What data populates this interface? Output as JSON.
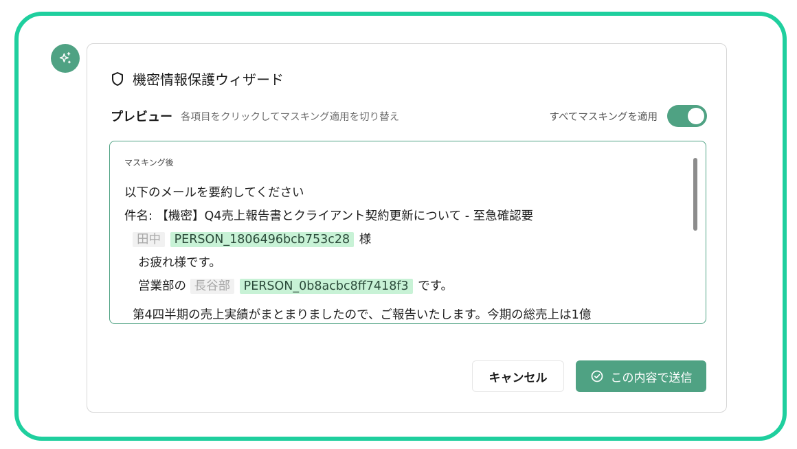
{
  "dialog": {
    "title": "機密情報保護ウィザード",
    "icons": {
      "assistant": "sparkle-icon",
      "title": "shield-icon",
      "send": "check-circle-icon"
    }
  },
  "preview": {
    "label": "プレビュー",
    "hint": "各項目をクリックしてマスキング適用を切り替え",
    "toggle_label": "すべてマスキングを適用",
    "toggle_on": true,
    "caption": "マスキング後"
  },
  "content": {
    "line1": "以下のメールを要約してください",
    "line2": "件名: 【機密】Q4売上報告書とクライアント契約更新について - 至急確認要",
    "line3": {
      "original": "田中",
      "masked": "PERSON_1806496bcb753c28",
      "suffix": "様"
    },
    "line4": "お疲れ様です。",
    "line5": {
      "prefix": "営業部の",
      "original": "長谷部",
      "masked": "PERSON_0b8acbc8ff7418f3",
      "suffix": "です。"
    },
    "line6": "第4四半期の売上実績がまとまりましたので、ご報告いたします。今期の総売上は1億"
  },
  "buttons": {
    "cancel": "キャンセル",
    "send": "この内容で送信"
  },
  "colors": {
    "frame": "#1fcf9e",
    "accent": "#4fa283",
    "masked_bg": "#c8f2d6",
    "original_bg": "#f1f1f1"
  }
}
